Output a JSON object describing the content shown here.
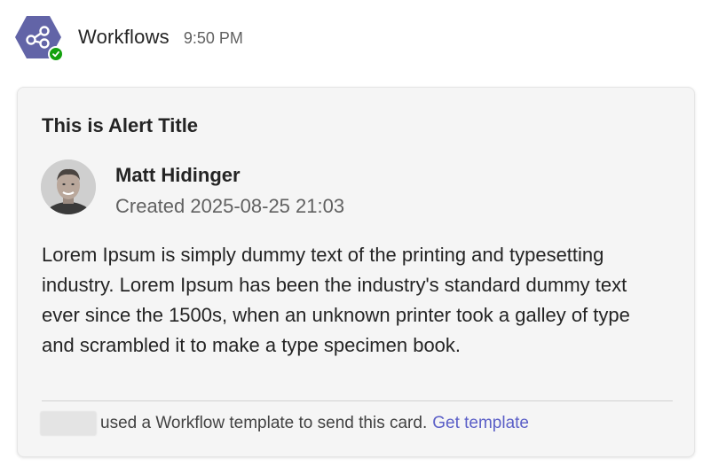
{
  "message": {
    "sender": "Workflows",
    "time": "9:50 PM",
    "avatar_icon": "workflow-icon",
    "avatar_color": "#6264a7",
    "status": "available",
    "status_color": "#13a10e"
  },
  "card": {
    "title": "This is Alert Title",
    "author": {
      "name": "Matt Hidinger",
      "created": "Created 2025-08-25 21:03"
    },
    "body": "Lorem Ipsum is simply dummy text of the printing and typesetting industry. Lorem Ipsum has been the industry's standard dummy text ever since the 1500s, when an unknown printer took a galley of type and scrambled it to make a type specimen book."
  },
  "footer": {
    "text": "used a Workflow template to send this card.",
    "link_label": "Get template",
    "link_color": "#5b5fc7"
  }
}
